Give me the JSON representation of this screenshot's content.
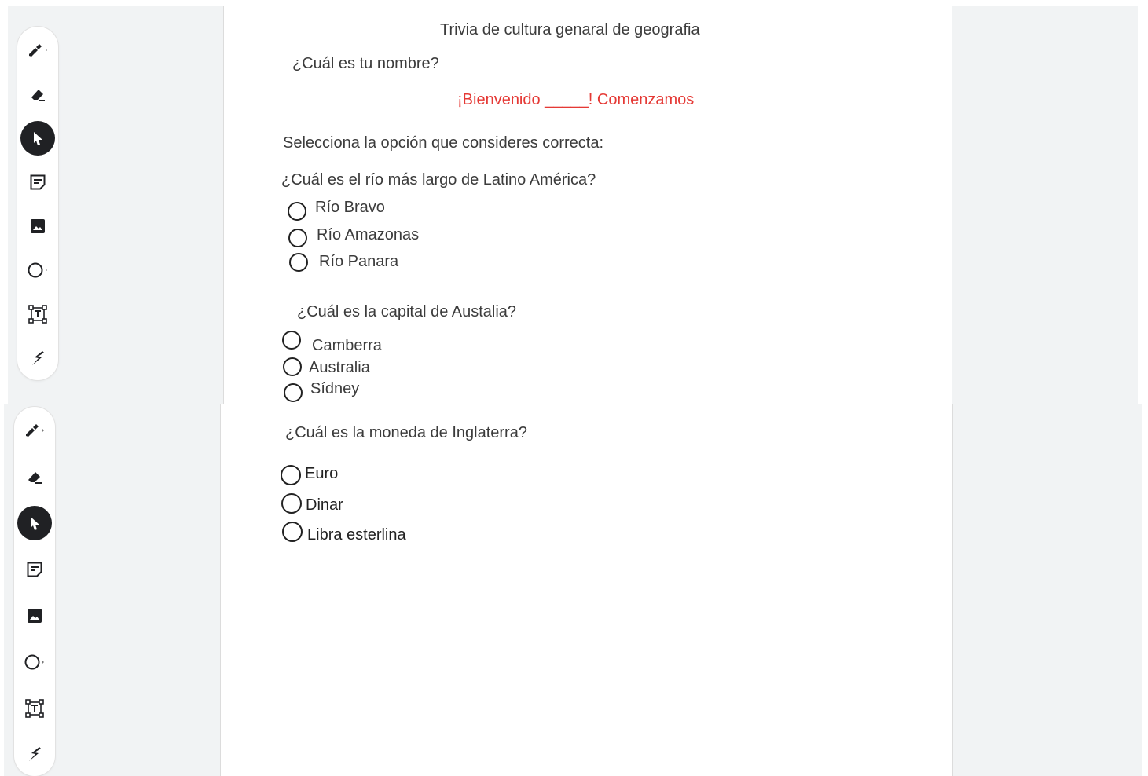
{
  "doc": {
    "title": "Trivia de cultura genaral de geografia",
    "name_question": "¿Cuál es tu nombre?",
    "welcome": "¡Bienvenido _____! Comenzamos",
    "instruction": "Selecciona la opción que consideres correcta:"
  },
  "questions": [
    {
      "text": "¿Cuál es el río más largo de Latino América?",
      "options": [
        "Río Bravo",
        "Río Amazonas",
        "Río Panara"
      ]
    },
    {
      "text": "¿Cuál es la capital de Austalia?",
      "options": [
        "Camberra",
        "Australia",
        "Sídney"
      ]
    },
    {
      "text": "¿Cuál es la moneda de Inglaterra?",
      "options": [
        "Euro",
        "Dinar",
        "Libra esterlina"
      ]
    }
  ],
  "toolbar": {
    "tools": [
      "pen-icon",
      "eraser-icon",
      "select-icon",
      "sticky-note-icon",
      "image-icon",
      "shape-icon",
      "text-box-icon",
      "laser-icon"
    ],
    "active": "select-icon"
  },
  "colors": {
    "welcome": "#e53935",
    "active_tool": "#202124",
    "background": "#f1f3f4"
  }
}
